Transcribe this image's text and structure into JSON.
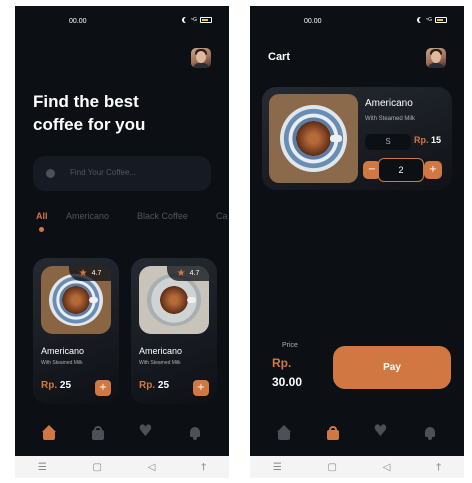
{
  "status": {
    "time": "00.00",
    "signal": "⁵G",
    "colors": {
      "battery": "#e8c53a"
    }
  },
  "home": {
    "headline": "Find the best coffee for you",
    "search_placeholder": "Find Your Coffee...",
    "tabs": [
      "All",
      "Americano",
      "Black Coffee",
      "Ca"
    ],
    "products": [
      {
        "rating": "4.7",
        "name": "Americano",
        "subtitle": "With Steamed Milk",
        "currency": "Rp.",
        "price": "25",
        "add": "+"
      },
      {
        "rating": "4.7",
        "name": "Americano",
        "subtitle": "With Steamed Milk",
        "currency": "Rp.",
        "price": "25",
        "add": "+"
      }
    ],
    "nav": [
      "home-icon",
      "bag-icon",
      "heart-icon",
      "bell-icon"
    ]
  },
  "cart": {
    "title": "Cart",
    "item": {
      "name": "Americano",
      "subtitle": "With Steamed Milk",
      "size": "S",
      "currency": "Rp.",
      "price": "15",
      "qty": "2",
      "minus": "−",
      "plus": "+"
    },
    "price_label": "Price",
    "total_currency": "Rp.",
    "total": "30.00",
    "pay": "Pay"
  },
  "android_nav": {
    "menu": "☰",
    "home": "▢",
    "back": "◁",
    "accessibility": "†"
  },
  "colors": {
    "accent": "#d17842",
    "background": "#0c0f14",
    "muted": "#52555c",
    "card": "#161a22"
  }
}
